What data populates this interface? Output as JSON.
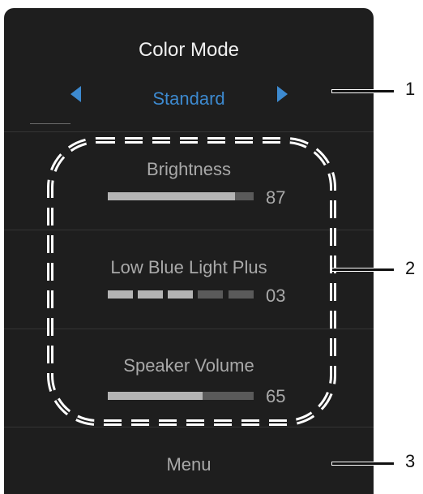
{
  "panel": {
    "title": "Color Mode",
    "mode_value": "Standard",
    "menu_label": "Menu"
  },
  "items": [
    {
      "label": "Brightness",
      "value_text": "87",
      "level": 0.87,
      "style": "bar"
    },
    {
      "label": "Low Blue Light Plus",
      "value_text": "03",
      "level": 3,
      "segments_total": 5,
      "style": "segments"
    },
    {
      "label": "Speaker Volume",
      "value_text": "65",
      "level": 0.65,
      "style": "bar"
    }
  ],
  "callouts": [
    "1",
    "2",
    "3"
  ],
  "colors": {
    "panel_background": "#1e1e1e",
    "accent": "#3d8ad0",
    "text_primary": "#f0f0f0",
    "text_secondary": "#a9a9a9",
    "bar_fill": "#b4b4b4",
    "bar_track": "#5a5a5a"
  },
  "icons": {
    "prev": "triangle-left-icon",
    "next": "triangle-right-icon"
  }
}
